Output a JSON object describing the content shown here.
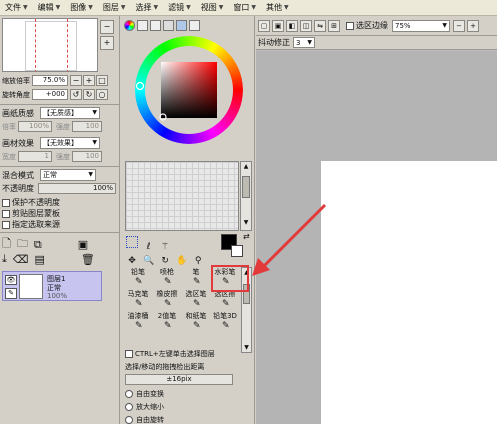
{
  "menu": {
    "items": [
      {
        "label": "文件"
      },
      {
        "label": "编辑"
      },
      {
        "label": "图像"
      },
      {
        "label": "图层"
      },
      {
        "label": "选择"
      },
      {
        "label": "滤镜"
      },
      {
        "label": "视图"
      },
      {
        "label": "窗口"
      },
      {
        "label": "其他"
      }
    ]
  },
  "navigator": {
    "zoom_label": "缩放倍率",
    "zoom_value": "75.0%",
    "rotate_label": "旋转角度",
    "rotate_value": "+000"
  },
  "paper": {
    "texture_label": "画纸质感",
    "texture_value": "【无质感】",
    "scale_label": "倍率",
    "scale_value": "100%",
    "strength_label": "强度",
    "strength_value": "100",
    "effect_label": "画材效果",
    "effect_value": "【无效果】",
    "width_label": "宽度",
    "width_value": "1",
    "effect_strength_label": "强度",
    "effect_strength_value": "100"
  },
  "layer": {
    "blend_label": "混合模式",
    "blend_value": "正常",
    "opacity_label": "不透明度",
    "opacity_value": "100%",
    "check_preserve": "保护不透明度",
    "check_clip": "剪贴图层蒙板",
    "check_source": "指定选取来源",
    "item_name": "图层1",
    "item_mode": "正常",
    "item_opacity": "100%"
  },
  "colors": {
    "accent": "#e23a3a",
    "layer_selected": "#c8c4f0"
  },
  "brushes": [
    {
      "label": "铅笔",
      "icon": "pencil-icon"
    },
    {
      "label": "喷枪",
      "icon": "airbrush-icon"
    },
    {
      "label": "笔",
      "icon": "pen-icon"
    },
    {
      "label": "水彩笔",
      "icon": "watercolor-icon"
    },
    {
      "label": "马克笔",
      "icon": "marker-icon"
    },
    {
      "label": "橡皮擦",
      "icon": "eraser-icon"
    },
    {
      "label": "选区笔",
      "icon": "select-pen-icon"
    },
    {
      "label": "选区擦",
      "icon": "select-eraser-icon"
    },
    {
      "label": "油漆桶",
      "icon": "bucket-icon"
    },
    {
      "label": "2值笔",
      "icon": "binary-pen-icon"
    },
    {
      "label": "和纸笔",
      "icon": "washi-pen-icon"
    },
    {
      "label": "铅笔3D",
      "icon": "pencil3d-icon"
    }
  ],
  "options": {
    "ctrl_label": "CTRL+左键单击选择图层",
    "drag_label": "选择/移动的拖拽检出距离",
    "drag_value": "±16pix",
    "radio_free": "自由变换",
    "radio_scale": "放大缩小",
    "radio_rotate": "自由旋转"
  },
  "toolbar": {
    "antialias_label": "选区边缘",
    "zoom_value": "75%",
    "stabilizer_label": "抖动修正",
    "stabilizer_value": "3"
  }
}
